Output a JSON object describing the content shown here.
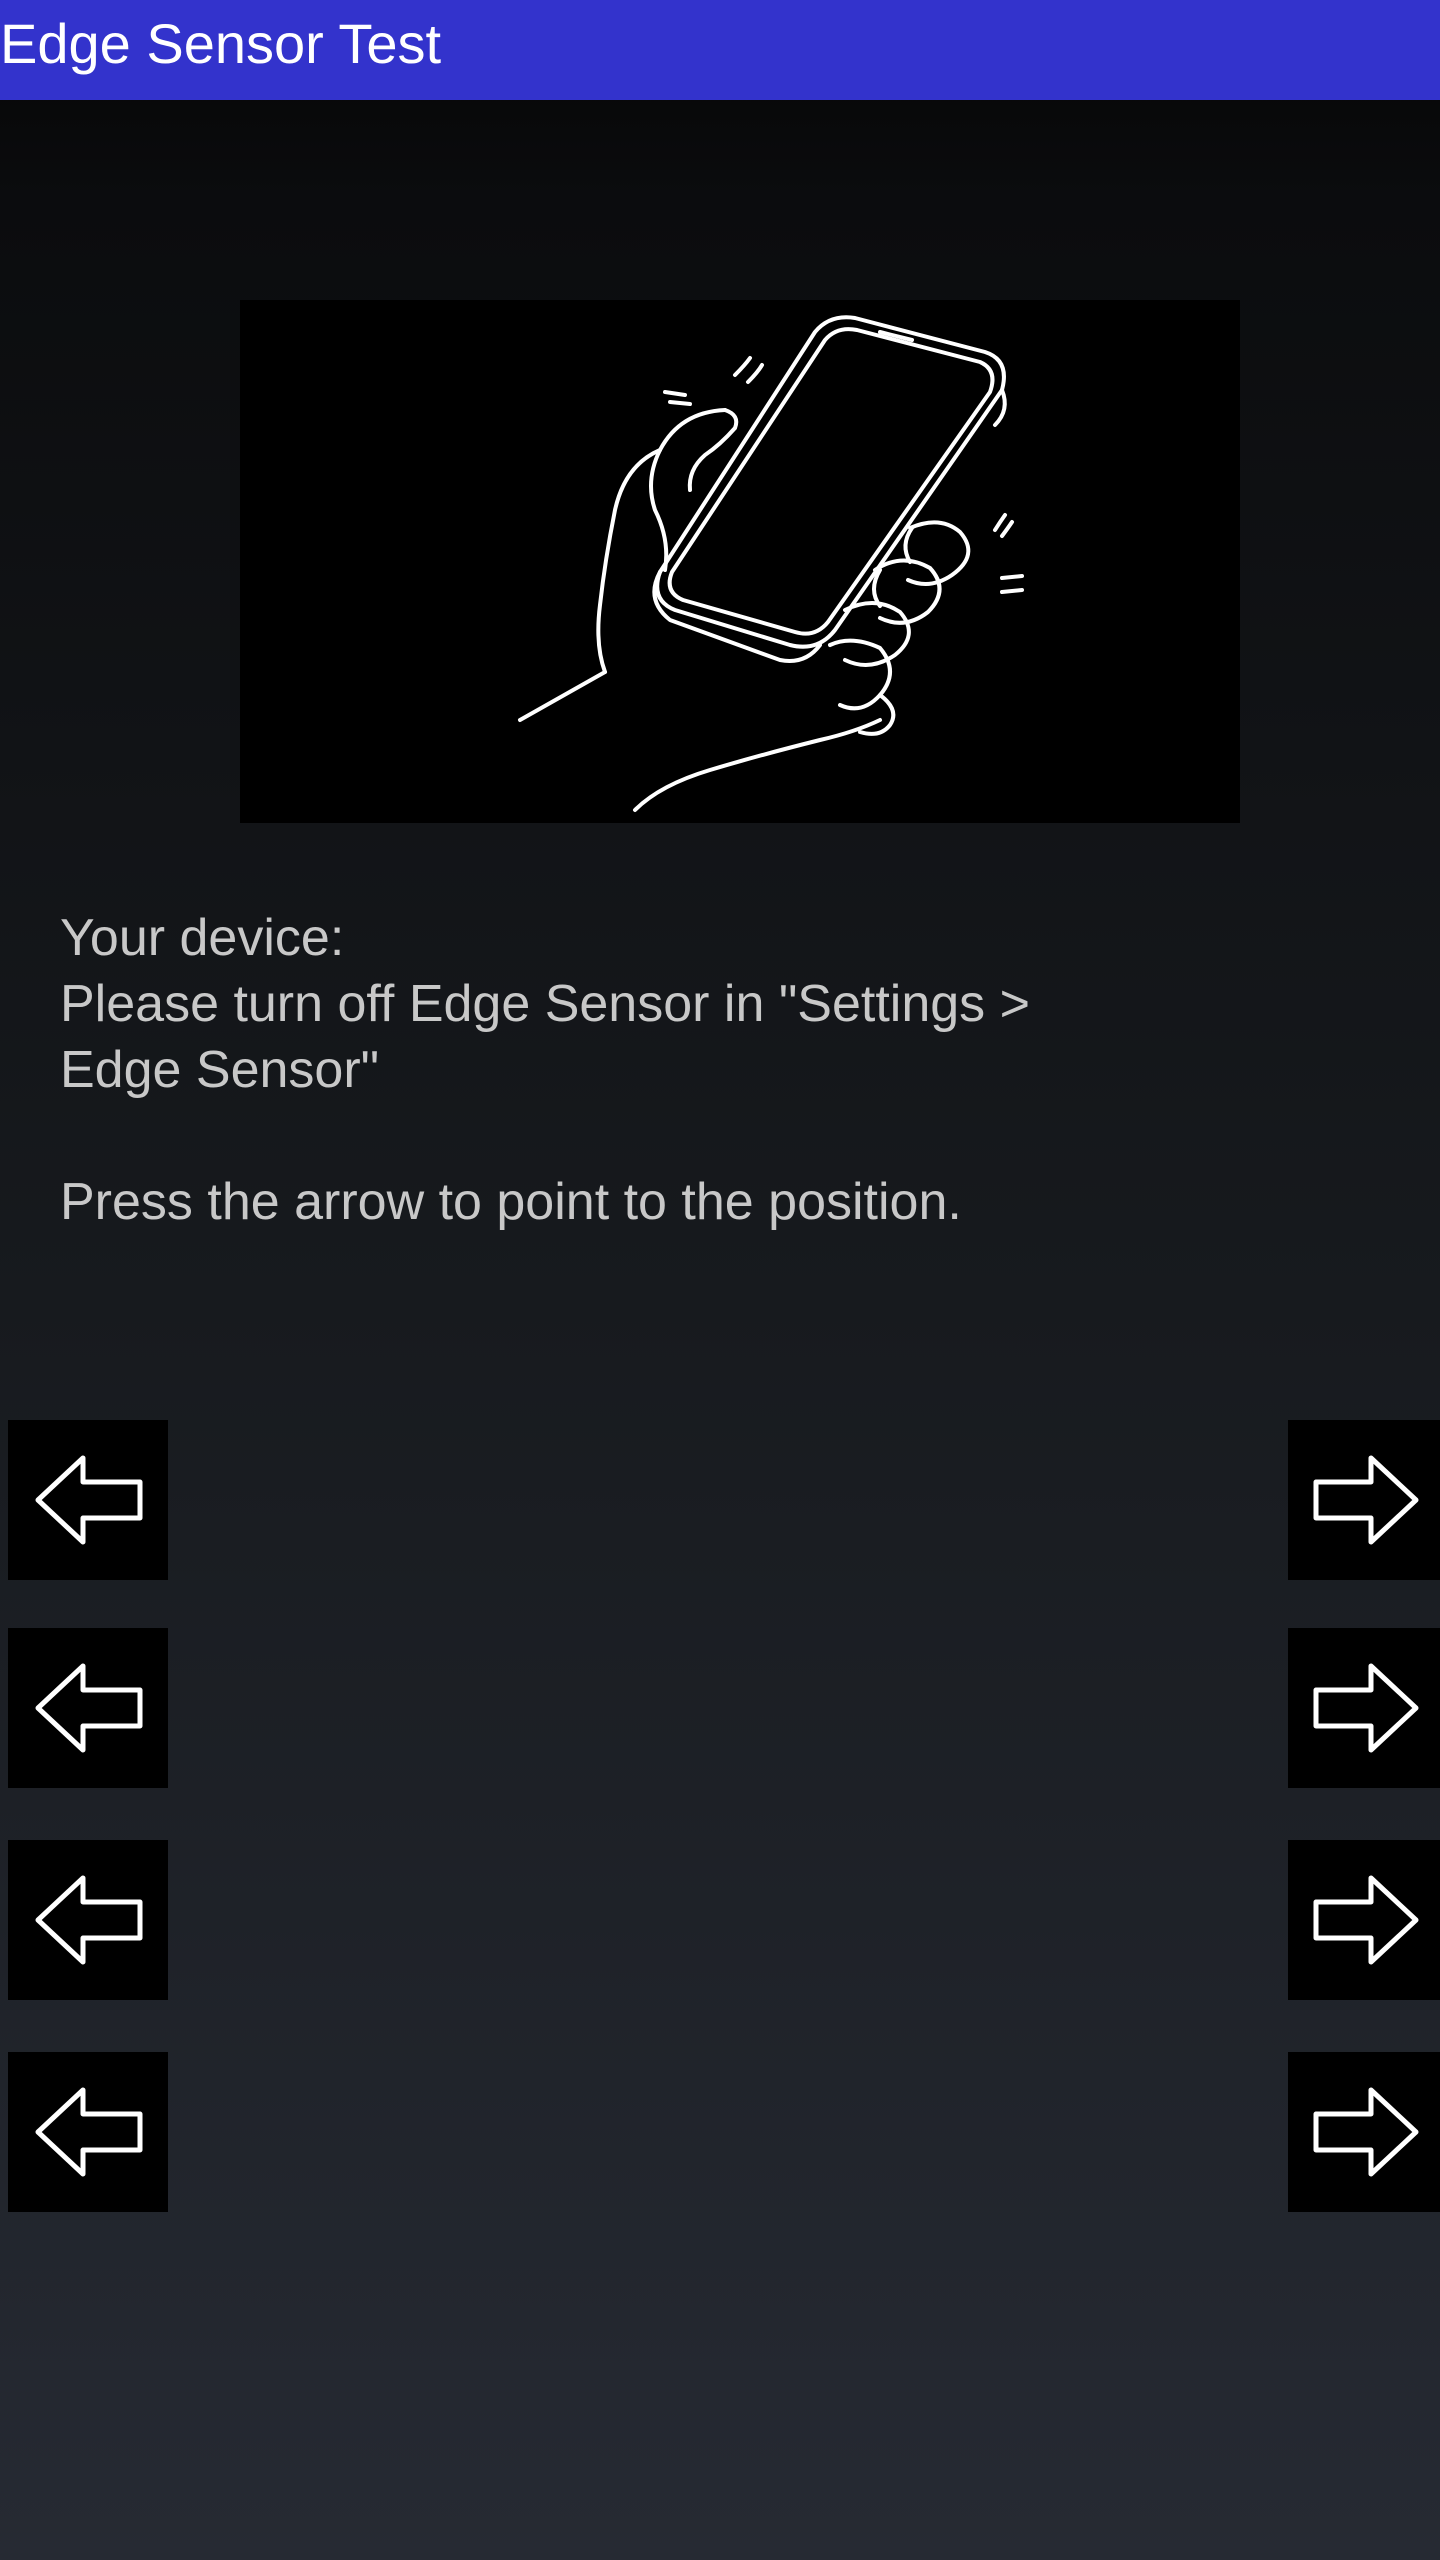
{
  "app_bar": {
    "title": "Edge Sensor Test",
    "color": "#3333cc"
  },
  "illustration": {
    "icon": "hand-squeezing-phone-illustration"
  },
  "instructions": {
    "line1": "Your device:",
    "line2": "Please turn off Edge Sensor in \"Settings >",
    "line3": "Edge Sensor\"",
    "line4": "Press the arrow to point to the position."
  },
  "arrows": {
    "left_icon": "arrow-left-icon",
    "right_icon": "arrow-right-icon",
    "rows": 4
  }
}
